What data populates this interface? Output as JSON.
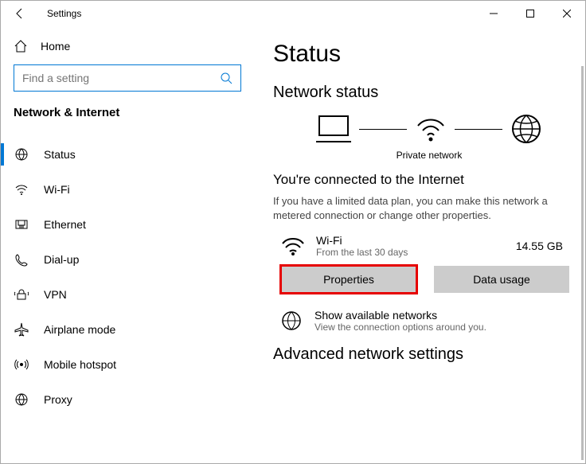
{
  "titlebar": {
    "title": "Settings"
  },
  "sidebar": {
    "home": "Home",
    "search_placeholder": "Find a setting",
    "section": "Network & Internet",
    "items": [
      {
        "label": "Status"
      },
      {
        "label": "Wi-Fi"
      },
      {
        "label": "Ethernet"
      },
      {
        "label": "Dial-up"
      },
      {
        "label": "VPN"
      },
      {
        "label": "Airplane mode"
      },
      {
        "label": "Mobile hotspot"
      },
      {
        "label": "Proxy"
      }
    ]
  },
  "main": {
    "title": "Status",
    "subtitle": "Network status",
    "diagram_caption": "Private network",
    "connected_title": "You're connected to the Internet",
    "connected_sub": "If you have a limited data plan, you can make this network a metered connection or change other properties.",
    "connection": {
      "name": "Wi-Fi",
      "period": "From the last 30 days",
      "data": "14.55 GB"
    },
    "buttons": {
      "properties": "Properties",
      "datausage": "Data usage"
    },
    "available": {
      "title": "Show available networks",
      "sub": "View the connection options around you."
    },
    "advanced": "Advanced network settings"
  }
}
